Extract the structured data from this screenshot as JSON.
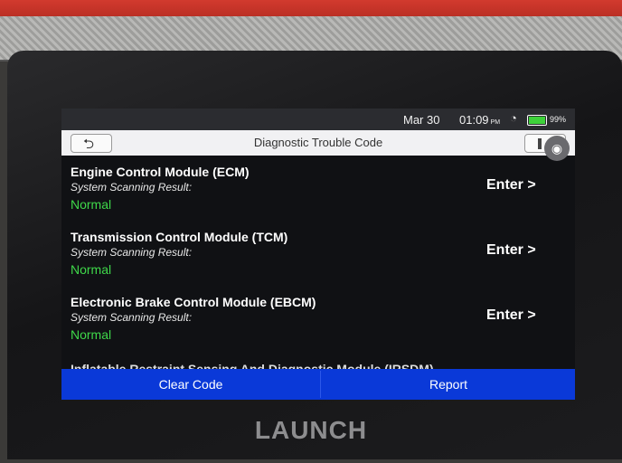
{
  "status_bar": {
    "date": "Mar 30",
    "time": "01:09",
    "ampm": "PM",
    "battery_percent_label": "99%",
    "battery_level": 0.99,
    "wifi_icon": "wifi-icon"
  },
  "header": {
    "title": "Diagnostic Trouble Code",
    "back_icon": "return-arrow-icon",
    "flag_icon": "flag-icon",
    "camera_icon": "camera-icon"
  },
  "modules": [
    {
      "name": "Engine Control Module (ECM)",
      "result_label": "System Scanning Result:",
      "status": "Normal",
      "action": "Enter >"
    },
    {
      "name": "Transmission Control Module (TCM)",
      "result_label": "System Scanning Result:",
      "status": "Normal",
      "action": "Enter >"
    },
    {
      "name": "Electronic Brake Control Module (EBCM)",
      "result_label": "System Scanning Result:",
      "status": "Normal",
      "action": "Enter >"
    }
  ],
  "partial_item": "Inflatable Restraint Sensing And Diagnostic Module (IRSDM)",
  "buttons": {
    "clear": "Clear Code",
    "report": "Report"
  },
  "colors": {
    "status_normal": "#3fd84a",
    "button_bar": "#0a39d8"
  },
  "brand": "LAUNCH"
}
